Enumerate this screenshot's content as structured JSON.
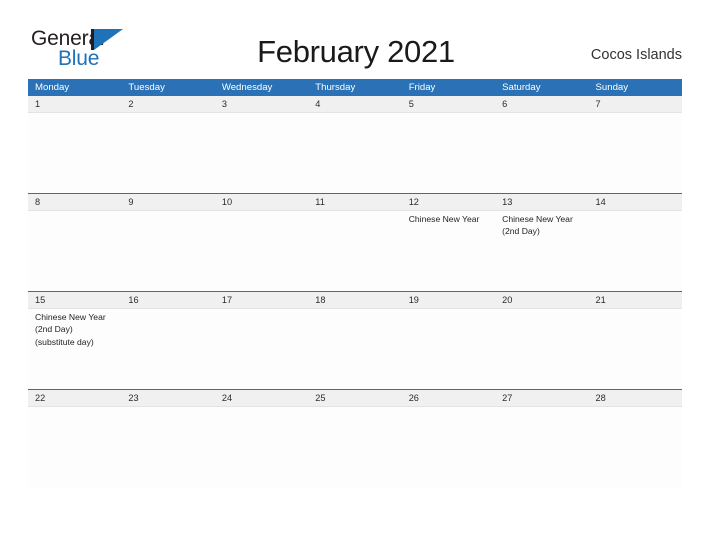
{
  "logo": {
    "word_one": "General",
    "word_two": "Blue",
    "triangle_color": "#1f72b8",
    "text_color": "#231f20"
  },
  "header": {
    "title": "February 2021",
    "region": "Cocos Islands"
  },
  "theme": {
    "accent": "#2a72b5",
    "date_band": "#f0f0f0",
    "page_background": "#ffffff"
  },
  "calendar": {
    "weekday_headers": [
      "Monday",
      "Tuesday",
      "Wednesday",
      "Thursday",
      "Friday",
      "Saturday",
      "Sunday"
    ],
    "weeks": [
      {
        "dates": [
          "1",
          "2",
          "3",
          "4",
          "5",
          "6",
          "7"
        ],
        "events": [
          {
            "lines": []
          },
          {
            "lines": []
          },
          {
            "lines": []
          },
          {
            "lines": []
          },
          {
            "lines": []
          },
          {
            "lines": []
          },
          {
            "lines": []
          }
        ]
      },
      {
        "dates": [
          "8",
          "9",
          "10",
          "11",
          "12",
          "13",
          "14"
        ],
        "events": [
          {
            "lines": []
          },
          {
            "lines": []
          },
          {
            "lines": []
          },
          {
            "lines": []
          },
          {
            "lines": [
              "Chinese New Year"
            ]
          },
          {
            "lines": [
              "Chinese New Year",
              "(2nd Day)"
            ]
          },
          {
            "lines": []
          }
        ]
      },
      {
        "dates": [
          "15",
          "16",
          "17",
          "18",
          "19",
          "20",
          "21"
        ],
        "events": [
          {
            "lines": [
              "Chinese New Year",
              "(2nd Day)",
              "(substitute day)"
            ]
          },
          {
            "lines": []
          },
          {
            "lines": []
          },
          {
            "lines": []
          },
          {
            "lines": []
          },
          {
            "lines": []
          },
          {
            "lines": []
          }
        ]
      },
      {
        "dates": [
          "22",
          "23",
          "24",
          "25",
          "26",
          "27",
          "28"
        ],
        "events": [
          {
            "lines": []
          },
          {
            "lines": []
          },
          {
            "lines": []
          },
          {
            "lines": []
          },
          {
            "lines": []
          },
          {
            "lines": []
          },
          {
            "lines": []
          }
        ]
      }
    ]
  }
}
